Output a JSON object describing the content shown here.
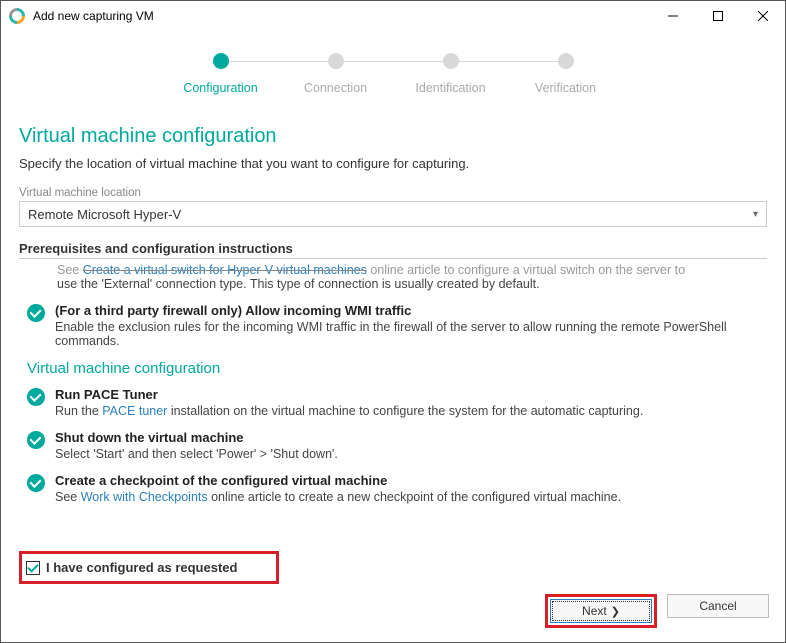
{
  "window": {
    "title": "Add new capturing VM"
  },
  "stepper": {
    "steps": [
      {
        "label": "Configuration",
        "active": true
      },
      {
        "label": "Connection",
        "active": false
      },
      {
        "label": "Identification",
        "active": false
      },
      {
        "label": "Verification",
        "active": false
      }
    ]
  },
  "heading": "Virtual machine configuration",
  "subheading": "Specify the location of virtual machine that you want to configure for capturing.",
  "vm_location_label": "Virtual machine location",
  "vm_location_value": "Remote Microsoft Hyper-V",
  "prereq_label": "Prerequisites and configuration instructions",
  "clip_top": {
    "prefix": "See ",
    "link": "Create a virtual switch for Hyper-V virtual machines",
    "rest": " online article to configure a virtual switch on the server to use the 'External' connection type. This type of connection is usually created by default."
  },
  "items": {
    "firewall": {
      "title": "(For a third party firewall only) Allow incoming WMI traffic",
      "desc": "Enable the exclusion rules for the incoming WMI traffic in the firewall of the server to allow running the remote PowerShell commands."
    },
    "runpace": {
      "title": "Run PACE Tuner",
      "desc_pre": "Run the ",
      "desc_link": "PACE tuner",
      "desc_post": " installation on the virtual machine to configure the system for the automatic capturing."
    },
    "shutdown": {
      "title": "Shut down the virtual machine",
      "desc": "Select 'Start' and then select 'Power' > 'Shut down'."
    },
    "checkpoint": {
      "title": "Create a checkpoint of the configured virtual machine",
      "desc_pre": "See ",
      "desc_link": "Work with Checkpoints",
      "desc_post": " online article to create a new checkpoint of the configured virtual machine."
    }
  },
  "section_heading": "Virtual machine configuration",
  "confirm_label": "I have configured as requested",
  "buttons": {
    "next": "Next",
    "cancel": "Cancel"
  }
}
